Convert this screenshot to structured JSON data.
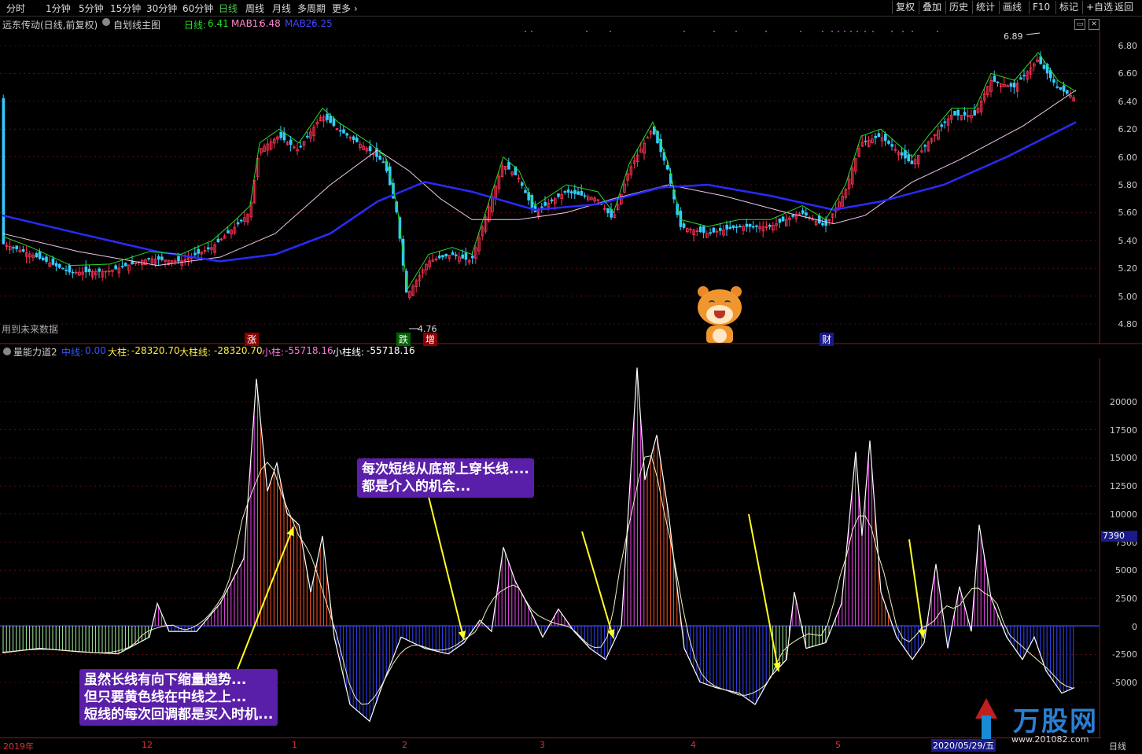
{
  "periods": [
    "分时",
    "1分钟",
    "5分钟",
    "15分钟",
    "30分钟",
    "60分钟",
    "日线",
    "周线",
    "月线",
    "多周期",
    "更多"
  ],
  "active_period": "日线",
  "right_buttons": [
    "复权",
    "叠加",
    "历史",
    "统计",
    "画线",
    "F10",
    "标记",
    "+自选",
    "返回"
  ],
  "price_header": {
    "title": "远东传动(日线,前复权)",
    "indicator": "自划线主图",
    "day_label": "日线:",
    "day_value": "6.41",
    "mab1_label": "MAB1:",
    "mab1_value": "6.48",
    "mab2_label": "MAB2:",
    "mab2_value": "6.25"
  },
  "price_axis": [
    "6.80",
    "6.60",
    "6.40",
    "6.20",
    "6.00",
    "5.80",
    "5.60",
    "5.40",
    "5.20",
    "5.00",
    "4.80"
  ],
  "price_high_label": "6.89",
  "price_low_label": "4.76",
  "future_data_note": "用到未来数据",
  "signals": [
    "涨",
    "跌",
    "增",
    "财"
  ],
  "vol_header": {
    "title": "量能力道2",
    "mid_label": "中线:",
    "mid_value": "0.00",
    "big_label": "大柱:",
    "big_value": "-28320.70",
    "bigline_label": "大柱线:",
    "bigline_value": "-28320.70",
    "small_label": "小柱:",
    "small_value": "-55718.16",
    "smallline_label": "小柱线:",
    "smallline_value": "-55718.16"
  },
  "vol_axis": [
    "20000",
    "17500",
    "15000",
    "12500",
    "10000",
    "7500",
    "5000",
    "2500",
    "0",
    "-2500",
    "-5000"
  ],
  "vol_marker": "7390",
  "callout_top": [
    "每次短线从底部上穿长线....",
    "都是介入的机会..."
  ],
  "callout_bottom": [
    "虽然长线有向下缩量趋势...",
    "但只要黄色线在中线之上...",
    "短线的每次回调都是买入时机..."
  ],
  "x_labels": [
    "2019年",
    "12",
    "1",
    "2",
    "3",
    "4",
    "5"
  ],
  "x_current": "2020/05/29/五",
  "x_right": "日线",
  "watermark": "万股网",
  "watermark_url": "www.201082.com",
  "colors": {
    "up": "#ff3355",
    "down": "#33ccff",
    "ma1": "#f0c8f0",
    "ma2": "#2a2aff",
    "short": "#22dd22",
    "grid": "#8b1a1a"
  }
}
